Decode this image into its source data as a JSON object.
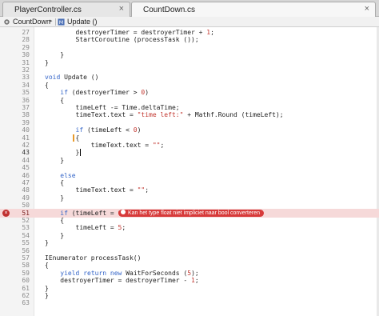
{
  "tabs": [
    {
      "label": "PlayerController.cs",
      "close": "×",
      "active": false
    },
    {
      "label": "CountDown.cs",
      "close": "×",
      "active": true
    }
  ],
  "breadcrumb": {
    "class_name": "CountDown",
    "method_name": "Update ()",
    "chevron": "▸"
  },
  "error": {
    "line": 51,
    "message": "Kan het type float niet impliciet naar bool converteren"
  },
  "colors": {
    "keyword": "#3465c8",
    "string": "#c2352e",
    "error_bg": "#f6d9d9",
    "error_bubble": "#d73a3a"
  },
  "editor": {
    "lines": [
      {
        "n": "27",
        "code": "            destroyerTimer = destroyerTimer + 1;"
      },
      {
        "n": "28",
        "code": "            StartCoroutine (processTask4 ());"
      },
      {
        "n": "29",
        "code": ""
      },
      {
        "n": "30",
        "code": "        }"
      },
      {
        "n": "31",
        "code": "    }"
      },
      {
        "n": "32",
        "code": ""
      },
      {
        "n": "33",
        "code": "    void Update ()"
      },
      {
        "n": "34",
        "code": "    {"
      },
      {
        "n": "35",
        "code": "        if (destroyerTimer > 0)"
      },
      {
        "n": "36",
        "code": "        {"
      },
      {
        "n": "37",
        "code": "            timeLeft -= Time.deltaTime;"
      },
      {
        "n": "38",
        "code": "            timeText.text = \"time left:\" + Mathf.Round (timeLeft);"
      },
      {
        "n": "39",
        "code": ""
      },
      {
        "n": "40",
        "code": "            if (timeLeft < 0)"
      },
      {
        "n": "41",
        "code": "            {"
      },
      {
        "n": "42",
        "code": "                timeText.text = \"\";"
      },
      {
        "n": "43",
        "code": "            }"
      },
      {
        "n": "44",
        "code": "        }"
      },
      {
        "n": "45",
        "code": ""
      },
      {
        "n": "46",
        "code": "        else"
      },
      {
        "n": "47",
        "code": "        {"
      },
      {
        "n": "48",
        "code": "            timeText.text = \"\";"
      },
      {
        "n": "49",
        "code": "        }"
      },
      {
        "n": "50",
        "code": ""
      },
      {
        "n": "51",
        "code": "        if (timeLeft = 0)"
      },
      {
        "n": "52",
        "code": "        {"
      },
      {
        "n": "53",
        "code": "            timeLeft = 5;"
      },
      {
        "n": "54",
        "code": "        }"
      },
      {
        "n": "55",
        "code": "    }"
      },
      {
        "n": "56",
        "code": ""
      },
      {
        "n": "57",
        "code": "    IEnumerator processTask4()"
      },
      {
        "n": "58",
        "code": "    {"
      },
      {
        "n": "59",
        "code": "        yield return new WaitForSeconds (5);"
      },
      {
        "n": "60",
        "code": "        destroyerTimer = destroyerTimer - 1;"
      },
      {
        "n": "61",
        "code": "    }"
      },
      {
        "n": "62",
        "code": "}"
      },
      {
        "n": "63",
        "code": ""
      }
    ]
  }
}
